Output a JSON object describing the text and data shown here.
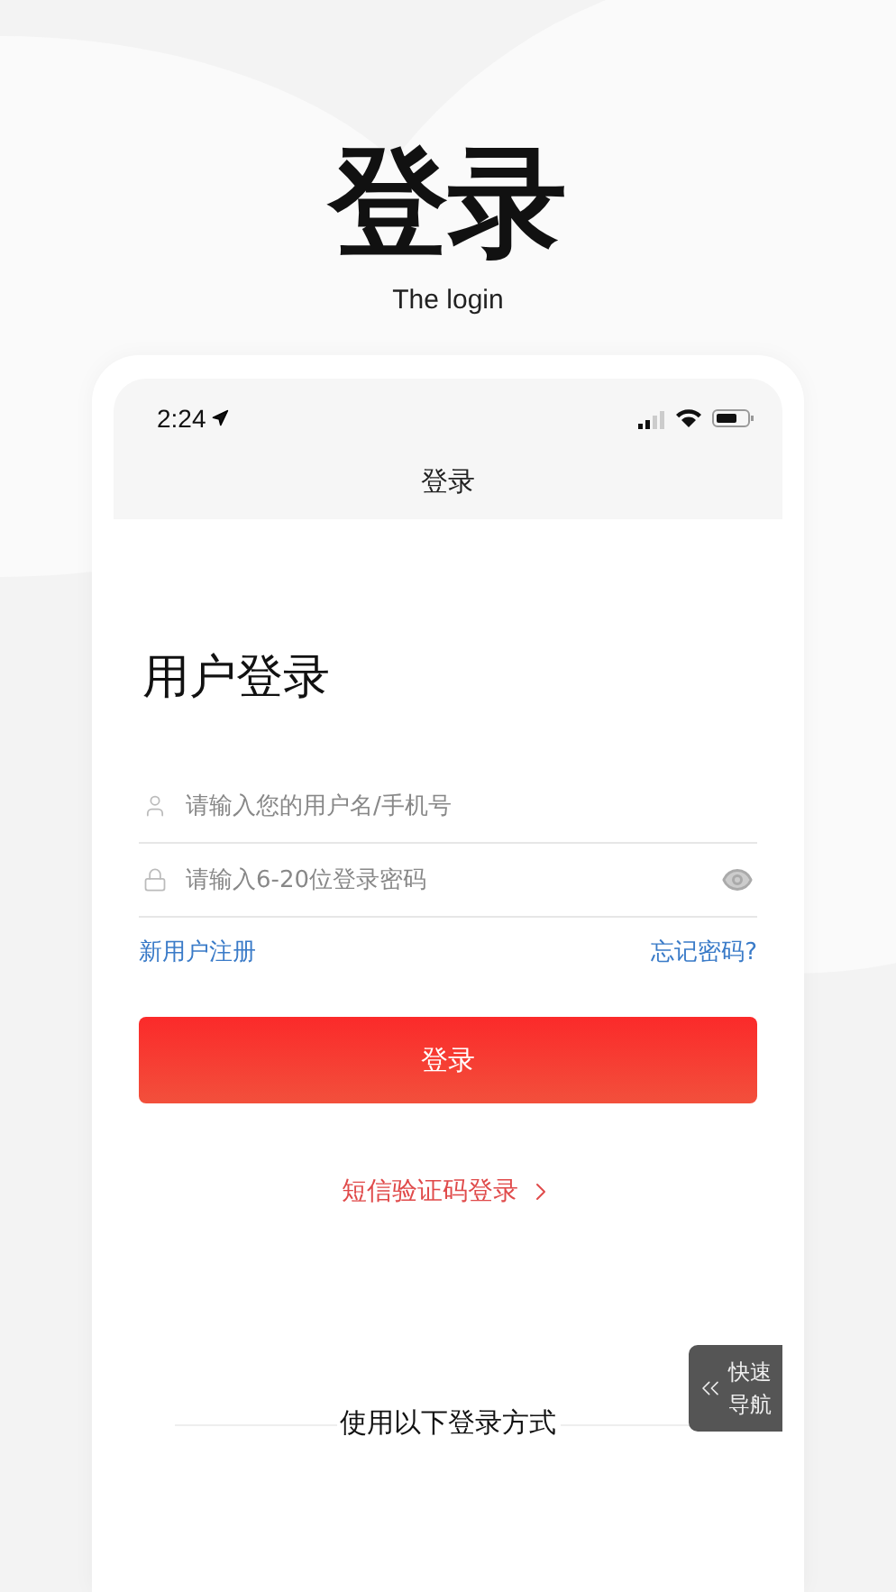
{
  "headline": "登录",
  "subtitle": "The login",
  "phone": {
    "status_bar": {
      "time": "2:24"
    },
    "nav_title": "登录",
    "page_title": "用户登录",
    "fields": [
      {
        "kind": "user",
        "placeholder": "请输入您的用户名/手机号"
      },
      {
        "kind": "password",
        "placeholder": "请输入6-20位登录密码"
      }
    ],
    "register_link": "新用户注册",
    "forgot_link": "忘记密码?",
    "login_button": "登录",
    "sms_login": "短信验证码登录",
    "quick_nav": [
      "快速",
      "导航"
    ],
    "other_methods": "使用以下登录方式"
  }
}
